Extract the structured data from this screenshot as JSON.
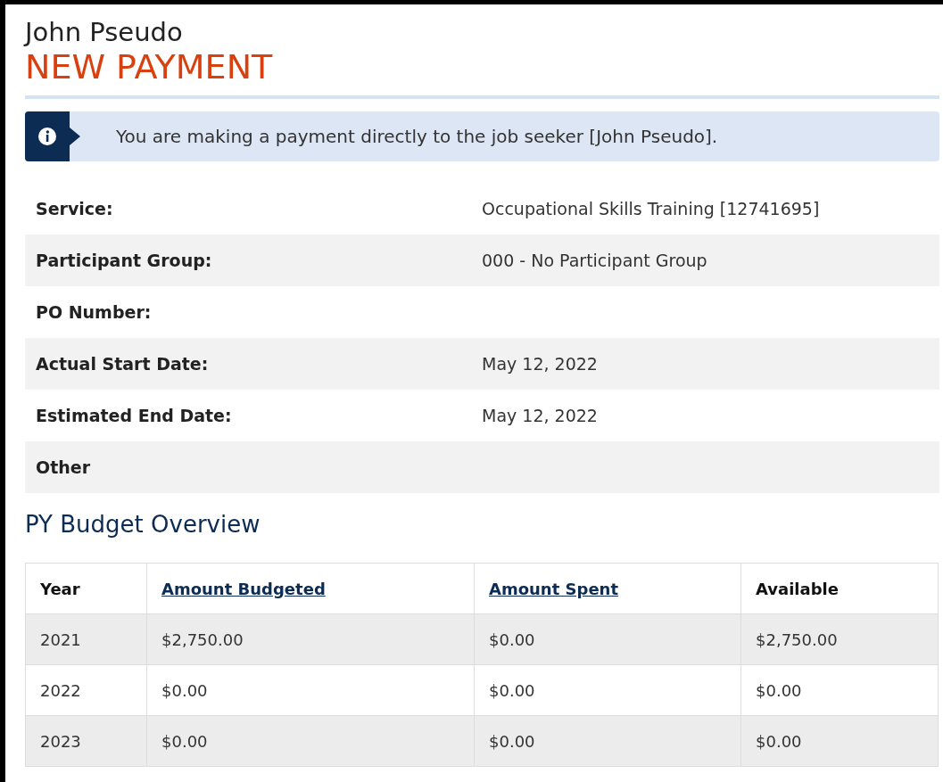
{
  "header": {
    "name": "John Pseudo",
    "title": "NEW PAYMENT"
  },
  "notice": {
    "text": "You are making a payment directly to the job seeker [John Pseudo]."
  },
  "details": [
    {
      "label": "Service:",
      "value": "Occupational Skills Training [12741695]"
    },
    {
      "label": "Participant Group:",
      "value": "000 - No Participant Group"
    },
    {
      "label": "PO Number:"
    },
    {
      "label": "Actual Start Date:",
      "value": "May 12, 2022"
    },
    {
      "label": "Estimated End Date:",
      "value": "May 12, 2022"
    },
    {
      "label": "Other"
    }
  ],
  "budget": {
    "heading": "PY Budget Overview",
    "columns": [
      {
        "label": "Year",
        "kind": "text"
      },
      {
        "label": "Amount Budgeted",
        "kind": "link"
      },
      {
        "label": "Amount Spent",
        "kind": "link"
      },
      {
        "label": "Available",
        "kind": "text"
      }
    ],
    "rows": [
      [
        "2021",
        "$2,750.00",
        "$0.00",
        "$2,750.00"
      ],
      [
        "2022",
        "$0.00",
        "$0.00",
        "$0.00"
      ],
      [
        "2023",
        "$0.00",
        "$0.00",
        "$0.00"
      ]
    ]
  }
}
